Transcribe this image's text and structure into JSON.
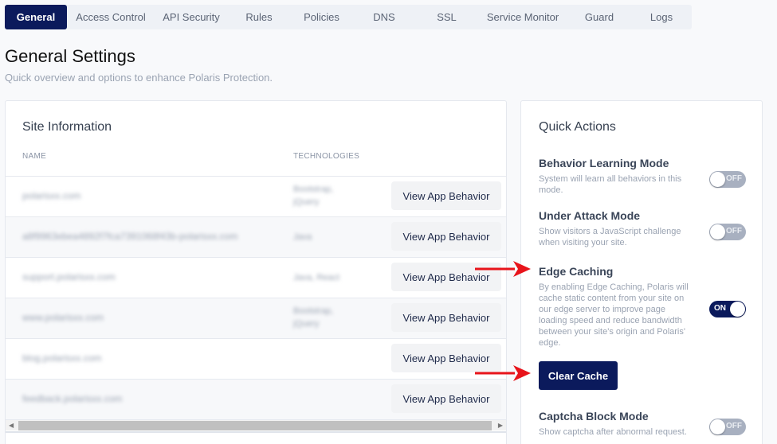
{
  "tabs": [
    {
      "label": "General",
      "active": true
    },
    {
      "label": "Access Control",
      "active": false
    },
    {
      "label": "API Security",
      "active": false
    },
    {
      "label": "Rules",
      "active": false
    },
    {
      "label": "Policies",
      "active": false
    },
    {
      "label": "DNS",
      "active": false
    },
    {
      "label": "SSL",
      "active": false
    },
    {
      "label": "Service Monitor",
      "active": false
    },
    {
      "label": "Guard",
      "active": false
    },
    {
      "label": "Logs",
      "active": false
    }
  ],
  "header": {
    "title": "General Settings",
    "subtitle": "Quick overview and options to enhance Polaris Protection."
  },
  "site_info": {
    "title": "Site Information",
    "columns": {
      "name": "NAME",
      "technologies": "TECHNOLOGIES"
    },
    "button_label": "View App Behavior",
    "rows": [
      {
        "name": "polarisxx.com",
        "technologies": "Bootstrap, jQuery"
      },
      {
        "name": "a8f9963ebea4892f7fca7391068f43b-polarisxx.com",
        "technologies": "Java"
      },
      {
        "name": "support.polarisxx.com",
        "technologies": "Java, React"
      },
      {
        "name": "www.polarisxx.com",
        "technologies": "Bootstrap, jQuery"
      },
      {
        "name": "blog.polarisxx.com",
        "technologies": ""
      },
      {
        "name": "feedback.polarisxx.com",
        "technologies": ""
      }
    ]
  },
  "quick_actions": {
    "title": "Quick Actions",
    "items": [
      {
        "name": "Behavior Learning Mode",
        "description": "System will learn all behaviors in this mode.",
        "state": "OFF"
      },
      {
        "name": "Under Attack Mode",
        "description": "Show visitors a JavaScript challenge when visiting your site.",
        "state": "OFF"
      },
      {
        "name": "Edge Caching",
        "description": "By enabling Edge Caching, Polaris will cache static content from your site on our edge server to improve page loading speed and reduce bandwidth between your site's origin and Polaris' edge.",
        "state": "ON"
      },
      {
        "name": "Captcha Block Mode",
        "description": "Show captcha after abnormal request.",
        "state": "OFF"
      }
    ],
    "clear_cache_label": "Clear Cache"
  },
  "colors": {
    "accent": "#0b1a5c",
    "annotation": "#e8141b"
  }
}
